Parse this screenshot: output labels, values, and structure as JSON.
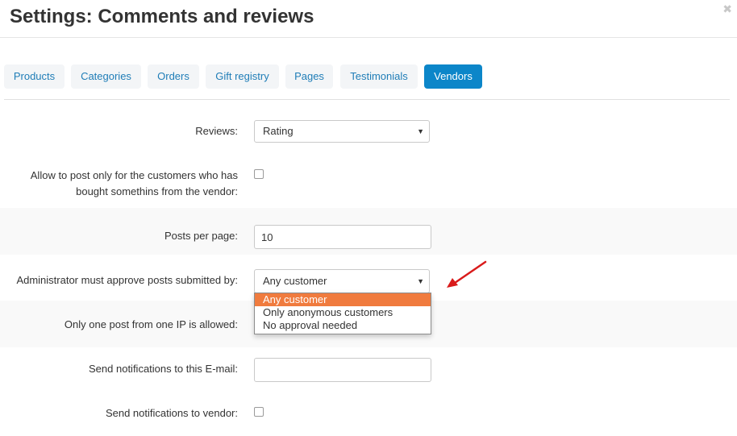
{
  "dialog": {
    "title": "Settings: Comments and reviews",
    "close_icon": "close-icon"
  },
  "tabs": [
    {
      "label": "Products",
      "active": false
    },
    {
      "label": "Categories",
      "active": false
    },
    {
      "label": "Orders",
      "active": false
    },
    {
      "label": "Gift registry",
      "active": false
    },
    {
      "label": "Pages",
      "active": false
    },
    {
      "label": "Testimonials",
      "active": false
    },
    {
      "label": "Vendors",
      "active": true
    }
  ],
  "fields": {
    "reviews": {
      "label": "Reviews:",
      "value": "Rating"
    },
    "allow_post": {
      "label_line1": "Allow to post only for the customers who has",
      "label_line2": "bought somethins from the vendor:",
      "checked": false
    },
    "posts_per_page": {
      "label": "Posts per page:",
      "value": "10"
    },
    "approve": {
      "label": "Administrator must approve posts submitted by:",
      "value": "Any customer",
      "options": [
        "Any customer",
        "Only anonymous customers",
        "No approval needed"
      ]
    },
    "one_post_ip": {
      "label": "Only one post from one IP is allowed:"
    },
    "notify_email": {
      "label": "Send notifications to this E-mail:",
      "value": ""
    },
    "notify_vendor": {
      "label": "Send notifications to vendor:",
      "checked": false
    }
  },
  "colors": {
    "accent": "#0c86c9",
    "tab_text": "#1f7db7",
    "highlight": "#f07b3e",
    "annotation_arrow": "#d91b1b"
  }
}
